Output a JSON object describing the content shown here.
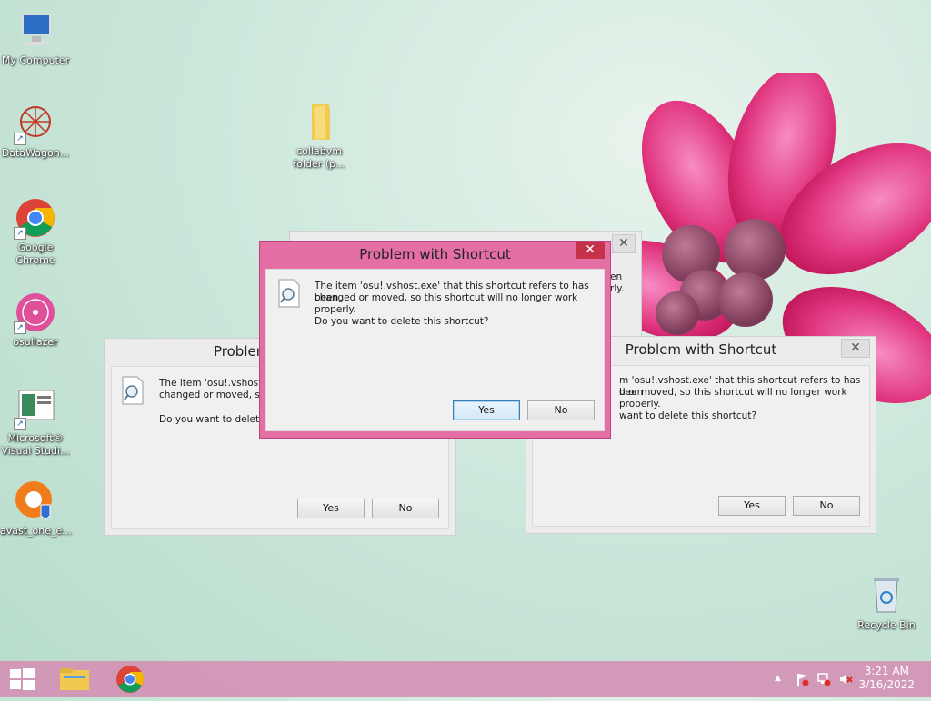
{
  "desktop": {
    "icons": [
      {
        "label": "My Computer"
      },
      {
        "label": "DataWagon..."
      },
      {
        "label": "Google Chrome"
      },
      {
        "label": "osullazer"
      },
      {
        "label": "Microsoft® Visual Studi..."
      },
      {
        "label": "avast_one_e..."
      },
      {
        "label": "collabvm folder (p..."
      },
      {
        "label": "Recycle Bin"
      }
    ]
  },
  "dialogs": {
    "front": {
      "title": "Problem with Shortcut",
      "close": "✕",
      "message_line1": "The item 'osu!.vshost.exe' that this shortcut refers to has been",
      "message_line2": "changed or moved, so this shortcut will no longer work properly.",
      "question": "Do you want to delete this shortcut?",
      "yes": "Yes",
      "no": "No"
    },
    "left": {
      "title": "Problem",
      "message_line1": "The item 'osu!.vshost.e",
      "message_line2": "changed or moved, so",
      "question": "Do you want to delete",
      "yes": "Yes",
      "no": "No"
    },
    "right": {
      "title": "Problem with Shortcut",
      "close": "✕",
      "message_line1": "m 'osu!.vshost.exe' that this shortcut refers to has been",
      "message_line2": "d or moved, so this shortcut will no longer work properly.",
      "question": "want to delete this shortcut?",
      "yes": "Yes",
      "no": "No"
    },
    "back": {
      "close": "✕",
      "line1": "en",
      "line2": "rly."
    }
  },
  "taskbar": {
    "time": "3:21 AM",
    "date": "3/16/2022",
    "tray_arrow": "▲"
  }
}
